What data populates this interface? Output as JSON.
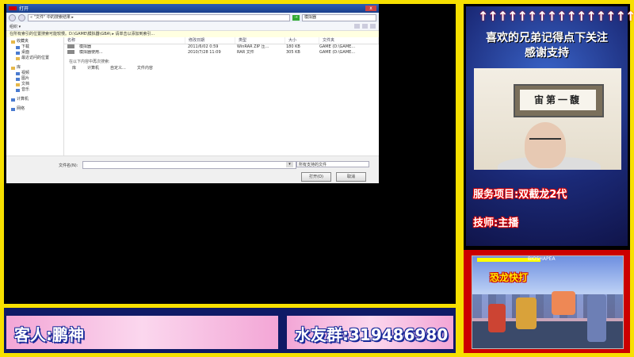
{
  "dialog": {
    "title": "打开",
    "close_glyph": "x",
    "address_path": "« \"文件\" 中的搜索结果 ▸",
    "search_value": "模拟器",
    "go_label": "→",
    "toolbar_label": "组织 ▾",
    "info_text": "在所有索引的位置搜索可能较慢。D:\\GAME\\模拟器\\GBA\\ ▸ 请单击以添加到索引...",
    "sidebar": {
      "favorites": "收藏夹",
      "downloads": "下载",
      "desktop": "桌面",
      "recent": "最近访问的位置",
      "libraries": "库",
      "videos": "视频",
      "pictures": "图片",
      "documents": "文档",
      "music": "音乐",
      "computer": "计算机",
      "network": "网络"
    },
    "columns": [
      "名称",
      "修改日期",
      "类型",
      "大小",
      "文件夹"
    ],
    "rows": [
      {
        "name": "模拟器",
        "date": "2011/6/02 0:59",
        "type": "WinRAR ZIP 压...",
        "size": "180 KB",
        "folder": "GAME (D:\\GAME..."
      },
      {
        "name": "模拟器使用...",
        "date": "2010/7/28 11:09",
        "type": "RAR 文件",
        "size": "305 KB",
        "folder": "GAME (D:\\GAME..."
      }
    ],
    "search_again": "在以下内容中再次搜索:",
    "search_locations": [
      "库",
      "计算机",
      "自定义...",
      "文件内容"
    ],
    "filename_label": "文件名(N):",
    "filename_value": "",
    "filetype_value": "所有支持的文件",
    "open_button": "打开(O)",
    "cancel_button": "取消"
  },
  "banners": {
    "guest": "客人:鹏神",
    "group": "水友群:319486980"
  },
  "right_panel": {
    "arrows": "↑↑↑↑↑↑↑↑↑↑↑↑↑↑↑↑↑↑",
    "line1": "喜欢的兄弟记得点下关注",
    "line2": "感谢支持",
    "plaque": "宙第一馥",
    "service": "服务项目:双截龙2代",
    "tech": "技师:主播"
  },
  "game": {
    "hud_name": "BIOSHAPEA",
    "combo": "恐龙快打"
  },
  "colors": {
    "frame_yellow": "#f7e000",
    "banner_pink": "#f3a6d6",
    "text_outline_blue": "#1a2a9a",
    "text_outline_red": "#dd0000"
  }
}
